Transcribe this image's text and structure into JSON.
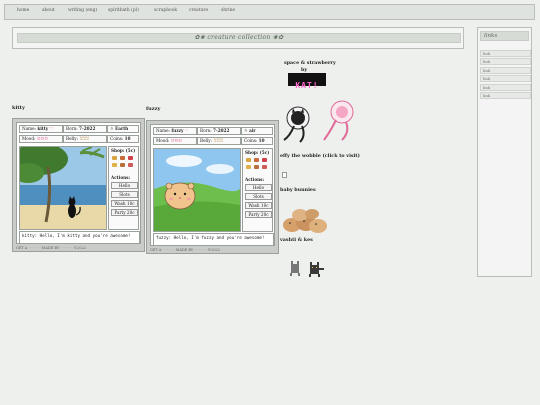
{
  "nav": {
    "items": [
      "home",
      "about",
      "writing (eng)",
      "spiritbath (pl)",
      "scrapbook",
      "creature",
      "shrine"
    ]
  },
  "title": "✿❀ creature collection ❀✿",
  "links": {
    "heading": "links",
    "items": [
      "link",
      "link",
      "link",
      "link",
      "link",
      "link"
    ]
  },
  "pets": [
    {
      "label": "kitty",
      "name": "kitty",
      "born": "7-2022",
      "location": "Earth",
      "mood": "☺☺☺",
      "belly": "ꈍꈍꈍ",
      "coins": "10",
      "shop_title": "Shop: (5c)",
      "actions_title": "Actions:",
      "actions": [
        "Hello",
        "Slots",
        "Wash 10c",
        "Party 20c"
      ],
      "speech": "kitty: Hello, I'm kitty and you're awesome!",
      "footer": "GET A · · · · · · MADE BY · · · · · · ©2022"
    },
    {
      "label": "fuzzy",
      "name": "fuzzy",
      "born": "7-2022",
      "location": "air",
      "mood": "☺☺☺",
      "belly": "ꈍꈍꈍ",
      "coins": "10",
      "shop_title": "Shop: (5c)",
      "actions_title": "Actions:",
      "actions": [
        "Hello",
        "Slots",
        "Wash 10c",
        "Party 20c"
      ],
      "speech": "fuzzy: Hello, I'm fuzzy and you're awesome!",
      "footer": "GET A · · · · · · MADE BY · · · · · · ©2022"
    }
  ],
  "right": {
    "title1": "space & strawberry",
    "title2": "by",
    "badge": "KAT!",
    "wobble": "effy the wobble (click to visit)",
    "bunnies": "baby bunnies",
    "vashti": "vashti & kes"
  },
  "colors": {
    "background": "#eef0ee",
    "accent": "#5d6b5d",
    "mood_pink": "#e0609a"
  }
}
